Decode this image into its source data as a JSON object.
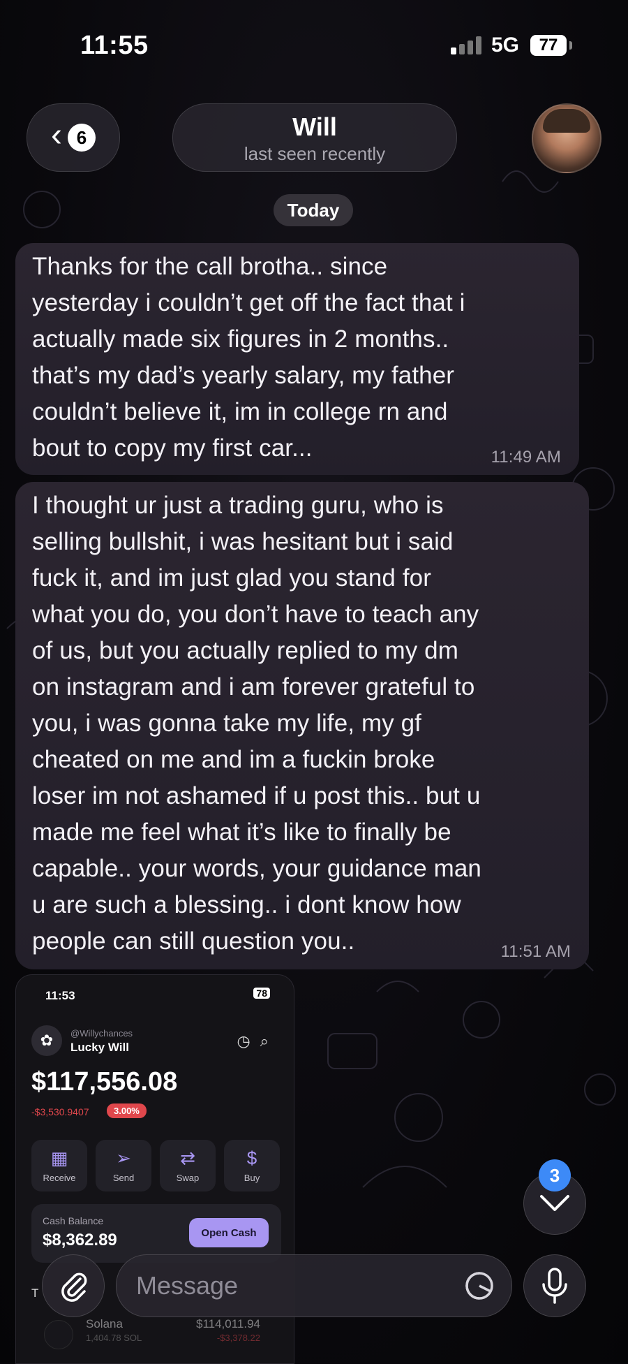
{
  "status_bar": {
    "time": "11:55",
    "network": "5G",
    "battery": "77"
  },
  "header": {
    "back_count": "6",
    "contact_name": "Will",
    "contact_status": "last seen recently"
  },
  "date_separator": "Today",
  "messages": [
    {
      "text": "Thanks for the call brotha.. since\nyesterday i couldn’t get off the fact that i\nactually made six figures in 2 months..\nthat’s my dad’s yearly salary, my father\ncouldn’t believe it, im in college rn and\nbout to copy my first car...",
      "time": "11:49 AM"
    },
    {
      "text": "I thought ur just a trading guru, who is\nselling bullshit, i was hesitant but i said\nfuck it, and im just glad you stand for\nwhat you do, you don’t have to teach any\nof us, but you actually replied to my dm\non instagram and i am forever grateful to\nyou, i was gonna take my life, my gf\ncheated on me and im a fuckin broke\nloser im not ashamed if u post this.. but u\nmade me feel what it’s like to finally be\ncapable.. your words, your guidance man\nu are such a blessing.. i dont know how\npeople can still question you..",
      "time": "11:51 AM"
    }
  ],
  "wallet_screenshot": {
    "status_time": "11:53",
    "status_battery": "78",
    "handle": "@Willychances",
    "account_name": "Lucky Will",
    "balance": "$117,556.08",
    "change": "-$3,530.9407",
    "change_pct": "3.00%",
    "actions": [
      {
        "label": "Receive",
        "icon": "qr-icon",
        "glyph": "▦"
      },
      {
        "label": "Send",
        "icon": "send-icon",
        "glyph": "➢"
      },
      {
        "label": "Swap",
        "icon": "swap-icon",
        "glyph": "⇄"
      },
      {
        "label": "Buy",
        "icon": "dollar-icon",
        "glyph": "$"
      }
    ],
    "cash_label": "Cash Balance",
    "cash_value": "$8,362.89",
    "cash_button": "Open Cash",
    "tokens_label": "T",
    "token": {
      "name": "Solana",
      "amount": "1,404.78 SOL",
      "value": "$114,011.94",
      "change": "-$3,378.22"
    }
  },
  "composer": {
    "placeholder": "Message"
  },
  "scroll": {
    "unread_count": "3"
  },
  "colors": {
    "accent": "#3d8af7",
    "bubble": "#2b2530",
    "wallet_accent": "#a896f2",
    "negative": "#e0474c"
  }
}
